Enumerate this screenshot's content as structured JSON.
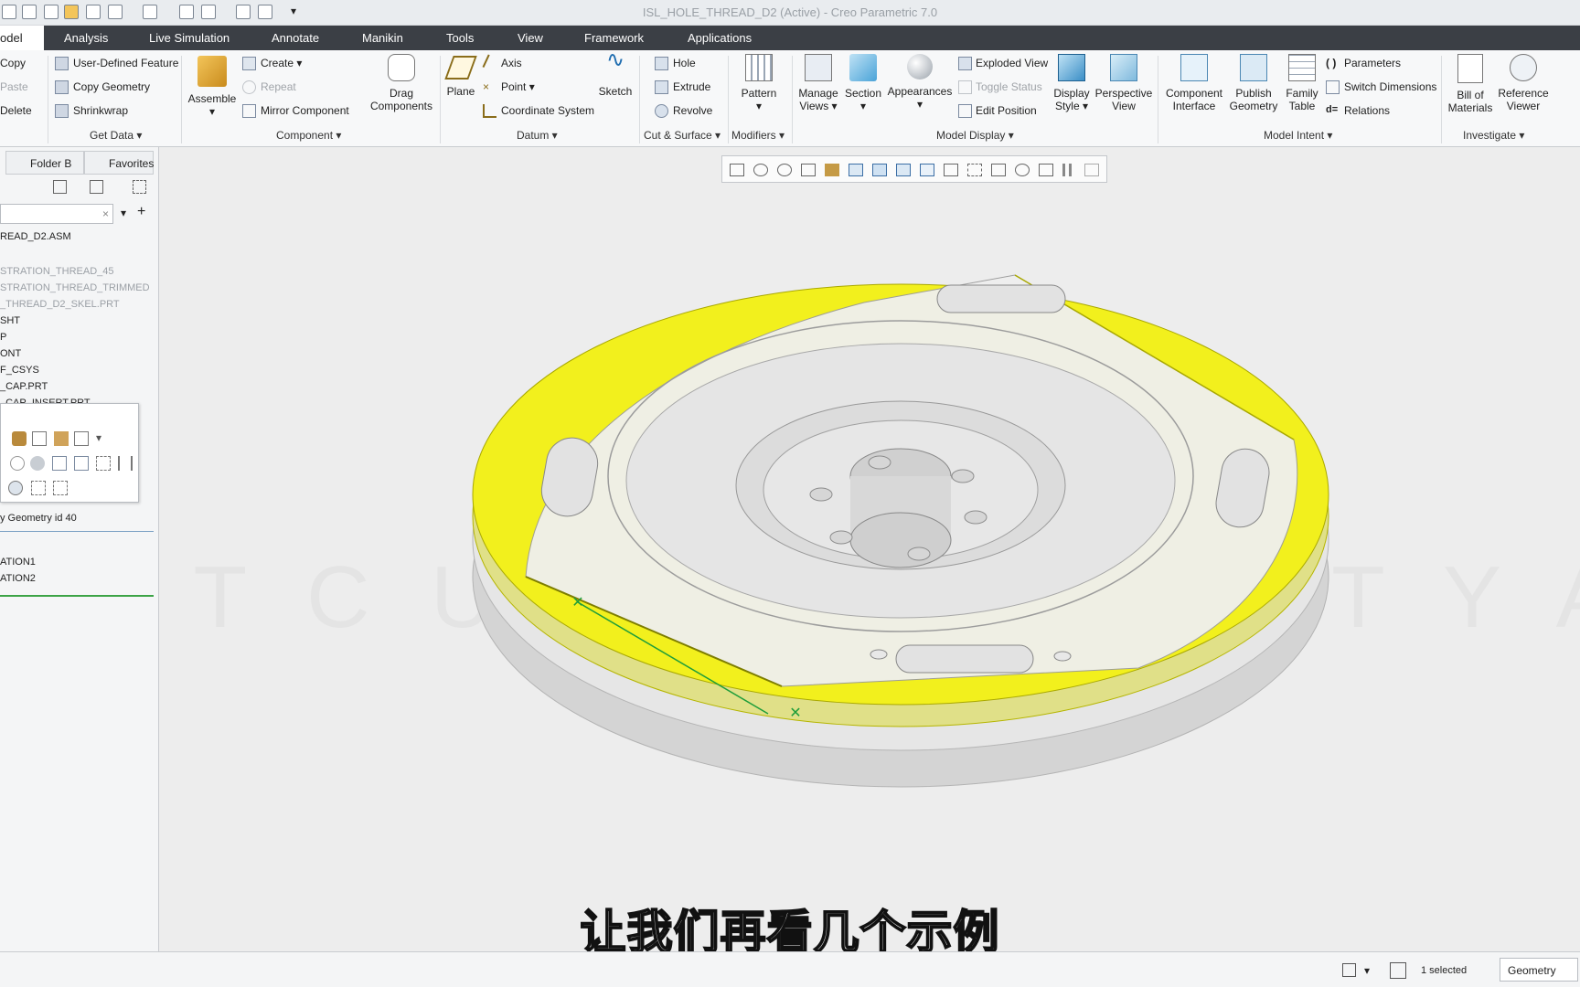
{
  "window_title": "ISL_HOLE_THREAD_D2 (Active) - Creo Parametric 7.0",
  "tabs": [
    "odel",
    "Analysis",
    "Live Simulation",
    "Annotate",
    "Manikin",
    "Tools",
    "View",
    "Framework",
    "Applications"
  ],
  "ribbon": {
    "operations": {
      "copy": "Copy",
      "paste": "Paste",
      "delete": "Delete"
    },
    "get_data": {
      "user_defined": "User-Defined Feature",
      "copy_geometry": "Copy Geometry",
      "shrinkwrap": "Shrinkwrap",
      "group": "Get Data"
    },
    "component": {
      "assemble": "Assemble",
      "create": "Create",
      "repeat": "Repeat",
      "mirror": "Mirror Component",
      "drag": "Drag Components",
      "group": "Component"
    },
    "datum": {
      "plane": "Plane",
      "axis": "Axis",
      "point": "Point",
      "csys": "Coordinate System",
      "sketch": "Sketch",
      "group": "Datum"
    },
    "cut_surface": {
      "hole": "Hole",
      "extrude": "Extrude",
      "revolve": "Revolve",
      "group": "Cut & Surface"
    },
    "modifiers": {
      "pattern": "Pattern",
      "group": "Modifiers"
    },
    "model_display": {
      "manage_views": "Manage Views",
      "section": "Section",
      "appearances": "Appearances",
      "exploded_view": "Exploded View",
      "toggle_status": "Toggle Status",
      "edit_position": "Edit Position",
      "display_style": "Display Style",
      "perspective_view": "Perspective View",
      "group": "Model Display"
    },
    "model_intent": {
      "component_interface": "Component Interface",
      "publish_geometry": "Publish Geometry",
      "family_table": "Family Table",
      "parameters": "Parameters",
      "switch_dimensions": "Switch Dimensions",
      "relations": "Relations",
      "group": "Model Intent"
    },
    "investigate": {
      "bom": "Bill of Materials",
      "reference_viewer": "Reference Viewer",
      "group": "Investigate"
    }
  },
  "left_panel": {
    "tabs": [
      "Folder B",
      "Favorites"
    ],
    "tree": [
      {
        "label": "READ_D2.ASM",
        "dim": false
      },
      {
        "label": "STRATION_THREAD_45",
        "dim": true
      },
      {
        "label": "STRATION_THREAD_TRIMMED",
        "dim": true
      },
      {
        "label": "_THREAD_D2_SKEL.PRT",
        "dim": true
      },
      {
        "label": "SHT",
        "dim": false
      },
      {
        "label": "P",
        "dim": false
      },
      {
        "label": "ONT",
        "dim": false
      },
      {
        "label": "F_CSYS",
        "dim": false
      },
      {
        "label": "_CAP.PRT",
        "dim": false
      },
      {
        "label": "_CAP_INSERT.PRT",
        "dim": false
      }
    ],
    "geometry_label": "y Geometry id 40",
    "bottom_items": [
      "ATION1",
      "ATION2"
    ]
  },
  "status": {
    "selected": "1 selected",
    "filter": "Geometry"
  },
  "watermark": "P T C   U N I V E R S I T Y   A",
  "subtitle": "让我们再看几个示例",
  "colors": {
    "highlight": "#f2f01d",
    "tab_bar": "#3b3f45"
  }
}
